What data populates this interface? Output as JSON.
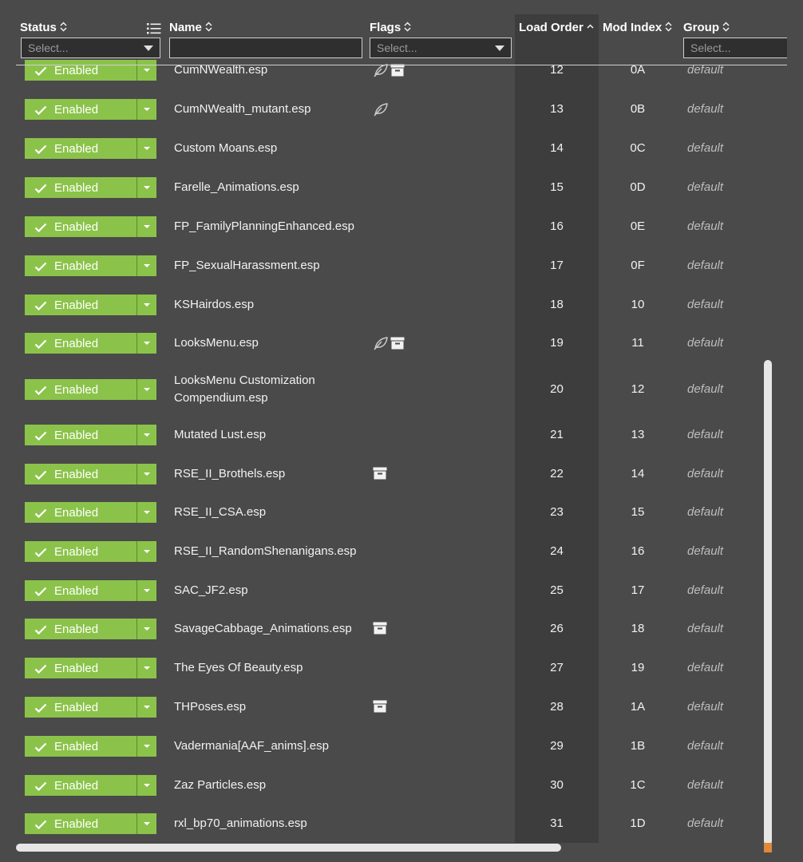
{
  "columns": {
    "status": "Status",
    "name": "Name",
    "flags": "Flags",
    "load_order": "Load Order",
    "mod_index": "Mod Index",
    "group": "Group"
  },
  "filters": {
    "status_placeholder": "Select...",
    "name_value": "",
    "flags_placeholder": "Select...",
    "group_placeholder": "Select..."
  },
  "sort": {
    "column": "Load Order",
    "direction": "ascending"
  },
  "colors": {
    "enabled_green": "#8bc34a",
    "background": "#4a4a4a",
    "sorted_column": "#3d3d3d",
    "scroll_thumb": "#e6e6e6",
    "scroll_corner": "#e0893a"
  },
  "rows": [
    {
      "status": "Enabled",
      "name": "CumNWealth.esp",
      "flags": [
        "leaf-icon",
        "archive-icon"
      ],
      "load_order": "12",
      "mod_index": "0A",
      "group": "default"
    },
    {
      "status": "Enabled",
      "name": "CumNWealth_mutant.esp",
      "flags": [
        "leaf-icon"
      ],
      "load_order": "13",
      "mod_index": "0B",
      "group": "default"
    },
    {
      "status": "Enabled",
      "name": "Custom Moans.esp",
      "flags": [],
      "load_order": "14",
      "mod_index": "0C",
      "group": "default"
    },
    {
      "status": "Enabled",
      "name": "Farelle_Animations.esp",
      "flags": [],
      "load_order": "15",
      "mod_index": "0D",
      "group": "default"
    },
    {
      "status": "Enabled",
      "name": "FP_FamilyPlanningEnhanced.esp",
      "flags": [],
      "load_order": "16",
      "mod_index": "0E",
      "group": "default"
    },
    {
      "status": "Enabled",
      "name": "FP_SexualHarassment.esp",
      "flags": [],
      "load_order": "17",
      "mod_index": "0F",
      "group": "default"
    },
    {
      "status": "Enabled",
      "name": "KSHairdos.esp",
      "flags": [],
      "load_order": "18",
      "mod_index": "10",
      "group": "default"
    },
    {
      "status": "Enabled",
      "name": "LooksMenu.esp",
      "flags": [
        "leaf-icon",
        "archive-icon"
      ],
      "load_order": "19",
      "mod_index": "11",
      "group": "default"
    },
    {
      "status": "Enabled",
      "name": "LooksMenu Customization Compendium.esp",
      "flags": [],
      "load_order": "20",
      "mod_index": "12",
      "group": "default"
    },
    {
      "status": "Enabled",
      "name": "Mutated Lust.esp",
      "flags": [],
      "load_order": "21",
      "mod_index": "13",
      "group": "default"
    },
    {
      "status": "Enabled",
      "name": "RSE_II_Brothels.esp",
      "flags": [
        "archive-icon"
      ],
      "load_order": "22",
      "mod_index": "14",
      "group": "default"
    },
    {
      "status": "Enabled",
      "name": "RSE_II_CSA.esp",
      "flags": [],
      "load_order": "23",
      "mod_index": "15",
      "group": "default"
    },
    {
      "status": "Enabled",
      "name": "RSE_II_RandomShenanigans.esp",
      "flags": [],
      "load_order": "24",
      "mod_index": "16",
      "group": "default"
    },
    {
      "status": "Enabled",
      "name": "SAC_JF2.esp",
      "flags": [],
      "load_order": "25",
      "mod_index": "17",
      "group": "default"
    },
    {
      "status": "Enabled",
      "name": "SavageCabbage_Animations.esp",
      "flags": [
        "archive-icon"
      ],
      "load_order": "26",
      "mod_index": "18",
      "group": "default"
    },
    {
      "status": "Enabled",
      "name": "The Eyes Of Beauty.esp",
      "flags": [],
      "load_order": "27",
      "mod_index": "19",
      "group": "default"
    },
    {
      "status": "Enabled",
      "name": "THPoses.esp",
      "flags": [
        "archive-icon"
      ],
      "load_order": "28",
      "mod_index": "1A",
      "group": "default"
    },
    {
      "status": "Enabled",
      "name": "Vadermania[AAF_anims].esp",
      "flags": [],
      "load_order": "29",
      "mod_index": "1B",
      "group": "default"
    },
    {
      "status": "Enabled",
      "name": "Zaz Particles.esp",
      "flags": [],
      "load_order": "30",
      "mod_index": "1C",
      "group": "default"
    },
    {
      "status": "Enabled",
      "name": "rxl_bp70_animations.esp",
      "flags": [],
      "load_order": "31",
      "mod_index": "1D",
      "group": "default"
    }
  ]
}
